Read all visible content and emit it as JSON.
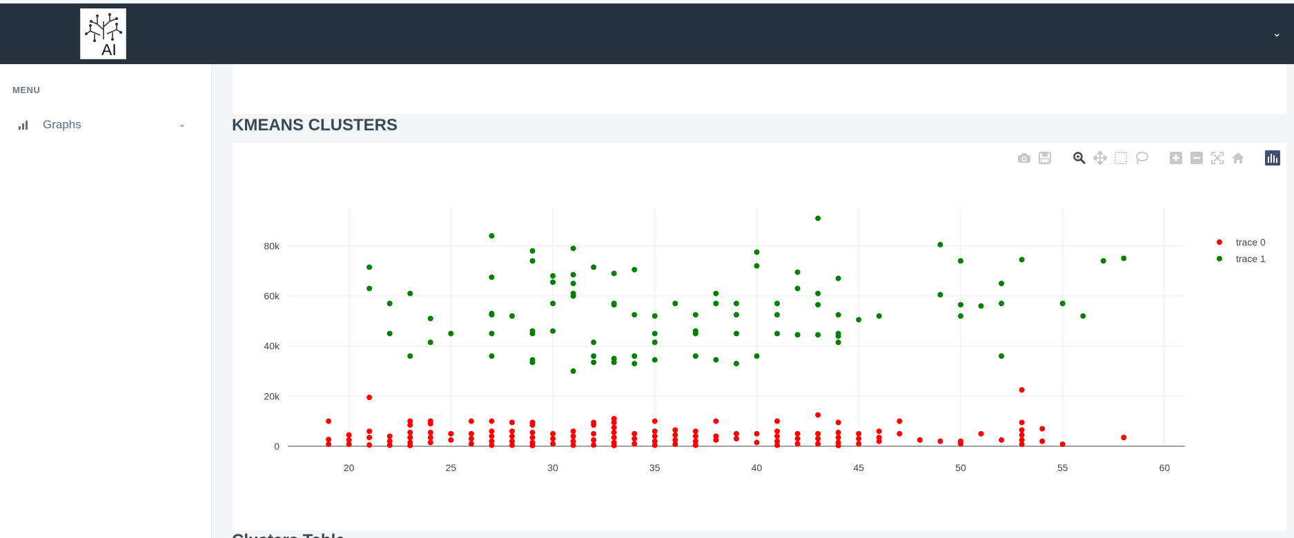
{
  "header": {
    "logo_text": "AI"
  },
  "sidebar": {
    "menu_title": "MENU",
    "items": [
      {
        "label": "Graphs",
        "icon": "bar-chart-icon"
      }
    ]
  },
  "main": {
    "section_title": "KMEANS CLUSTERS",
    "next_section_title": "Clusters Table"
  },
  "modebar": {
    "buttons": [
      "camera-icon",
      "save-icon",
      "zoom-icon",
      "pan-icon",
      "box-select-icon",
      "lasso-icon",
      "zoom-in-icon",
      "zoom-out-icon",
      "autoscale-icon",
      "reset-axes-icon",
      "plotly-logo-icon"
    ]
  },
  "chart_data": {
    "type": "scatter",
    "xlim": [
      17,
      61
    ],
    "ylim": [
      0,
      95000
    ],
    "xticks": [
      20,
      25,
      30,
      35,
      40,
      45,
      50,
      55,
      60
    ],
    "yticks": [
      0,
      20000,
      40000,
      60000,
      80000
    ],
    "ytick_labels": [
      "0",
      "20k",
      "40k",
      "60k",
      "80k"
    ],
    "grid": true,
    "legend": "top-right",
    "series": [
      {
        "name": "trace 0",
        "color": "#ff0000",
        "points": [
          [
            19,
            10000
          ],
          [
            19,
            2700
          ],
          [
            19,
            800
          ],
          [
            20,
            4500
          ],
          [
            20,
            2500
          ],
          [
            20,
            800
          ],
          [
            21,
            19500
          ],
          [
            21,
            6000
          ],
          [
            21,
            3500
          ],
          [
            21,
            500
          ],
          [
            22,
            4000
          ],
          [
            22,
            2000
          ],
          [
            22,
            400
          ],
          [
            23,
            10000
          ],
          [
            23,
            8500
          ],
          [
            23,
            5500
          ],
          [
            23,
            3500
          ],
          [
            23,
            1500
          ],
          [
            23,
            300
          ],
          [
            24,
            10000
          ],
          [
            24,
            9000
          ],
          [
            24,
            5500
          ],
          [
            24,
            3500
          ],
          [
            24,
            1500
          ],
          [
            25,
            5000
          ],
          [
            25,
            2500
          ],
          [
            26,
            10000
          ],
          [
            26,
            5000
          ],
          [
            26,
            3000
          ],
          [
            26,
            1000
          ],
          [
            27,
            10000
          ],
          [
            27,
            6000
          ],
          [
            27,
            4000
          ],
          [
            27,
            2000
          ],
          [
            27,
            400
          ],
          [
            28,
            9500
          ],
          [
            28,
            6000
          ],
          [
            28,
            4000
          ],
          [
            28,
            2000
          ],
          [
            28,
            400
          ],
          [
            29,
            9500
          ],
          [
            29,
            8500
          ],
          [
            29,
            5500
          ],
          [
            29,
            3500
          ],
          [
            29,
            1500
          ],
          [
            29,
            300
          ],
          [
            30,
            5000
          ],
          [
            30,
            3000
          ],
          [
            30,
            1000
          ],
          [
            31,
            6000
          ],
          [
            31,
            4000
          ],
          [
            31,
            2000
          ],
          [
            31,
            400
          ],
          [
            32,
            9500
          ],
          [
            32,
            8500
          ],
          [
            32,
            5000
          ],
          [
            32,
            2500
          ],
          [
            32,
            500
          ],
          [
            33,
            11000
          ],
          [
            33,
            9500
          ],
          [
            33,
            7500
          ],
          [
            33,
            5500
          ],
          [
            33,
            3500
          ],
          [
            33,
            1500
          ],
          [
            33,
            300
          ],
          [
            34,
            5000
          ],
          [
            34,
            3000
          ],
          [
            34,
            1000
          ],
          [
            35,
            10000
          ],
          [
            35,
            6000
          ],
          [
            35,
            4000
          ],
          [
            35,
            2000
          ],
          [
            35,
            400
          ],
          [
            36,
            6500
          ],
          [
            36,
            4500
          ],
          [
            36,
            2500
          ],
          [
            36,
            800
          ],
          [
            37,
            6000
          ],
          [
            37,
            4000
          ],
          [
            37,
            2000
          ],
          [
            37,
            400
          ],
          [
            38,
            10000
          ],
          [
            38,
            4000
          ],
          [
            38,
            2500
          ],
          [
            39,
            5000
          ],
          [
            39,
            3000
          ],
          [
            40,
            5000
          ],
          [
            40,
            1500
          ],
          [
            41,
            10000
          ],
          [
            41,
            6000
          ],
          [
            41,
            4000
          ],
          [
            41,
            2000
          ],
          [
            41,
            400
          ],
          [
            42,
            5000
          ],
          [
            42,
            3000
          ],
          [
            42,
            1000
          ],
          [
            43,
            12500
          ],
          [
            43,
            5000
          ],
          [
            43,
            3000
          ],
          [
            43,
            1000
          ],
          [
            44,
            9500
          ],
          [
            44,
            5500
          ],
          [
            44,
            3500
          ],
          [
            44,
            1500
          ],
          [
            44,
            300
          ],
          [
            45,
            5000
          ],
          [
            45,
            3000
          ],
          [
            45,
            1000
          ],
          [
            46,
            6000
          ],
          [
            46,
            3500
          ],
          [
            46,
            2000
          ],
          [
            47,
            10000
          ],
          [
            47,
            5000
          ],
          [
            48,
            2500
          ],
          [
            49,
            2000
          ],
          [
            50,
            2000
          ],
          [
            50,
            1000
          ],
          [
            51,
            5000
          ],
          [
            52,
            2500
          ],
          [
            53,
            22500
          ],
          [
            53,
            9500
          ],
          [
            53,
            6500
          ],
          [
            53,
            4500
          ],
          [
            53,
            2500
          ],
          [
            53,
            800
          ],
          [
            54,
            7000
          ],
          [
            54,
            2000
          ],
          [
            55,
            800
          ],
          [
            58,
            3500
          ]
        ]
      },
      {
        "name": "trace 1",
        "color": "#008000",
        "points": [
          [
            21,
            71500
          ],
          [
            21,
            63000
          ],
          [
            22,
            57000
          ],
          [
            22,
            45000
          ],
          [
            23,
            61000
          ],
          [
            23,
            36000
          ],
          [
            24,
            51000
          ],
          [
            24,
            41500
          ],
          [
            25,
            45000
          ],
          [
            27,
            84000
          ],
          [
            27,
            67500
          ],
          [
            27,
            53000
          ],
          [
            27,
            52500
          ],
          [
            27,
            45000
          ],
          [
            27,
            36000
          ],
          [
            28,
            52000
          ],
          [
            29,
            78000
          ],
          [
            29,
            74000
          ],
          [
            29,
            46000
          ],
          [
            29,
            45000
          ],
          [
            29,
            34500
          ],
          [
            29,
            33500
          ],
          [
            30,
            68000
          ],
          [
            30,
            65500
          ],
          [
            30,
            57000
          ],
          [
            30,
            46000
          ],
          [
            31,
            79000
          ],
          [
            31,
            68500
          ],
          [
            31,
            65000
          ],
          [
            31,
            61000
          ],
          [
            31,
            60000
          ],
          [
            31,
            30000
          ],
          [
            32,
            71500
          ],
          [
            32,
            41500
          ],
          [
            32,
            36000
          ],
          [
            32,
            33500
          ],
          [
            33,
            69000
          ],
          [
            33,
            57000
          ],
          [
            33,
            56500
          ],
          [
            33,
            35000
          ],
          [
            33,
            33500
          ],
          [
            34,
            70500
          ],
          [
            34,
            52500
          ],
          [
            34,
            36000
          ],
          [
            34,
            33000
          ],
          [
            35,
            52000
          ],
          [
            35,
            45000
          ],
          [
            35,
            41500
          ],
          [
            35,
            34500
          ],
          [
            36,
            57000
          ],
          [
            37,
            52500
          ],
          [
            37,
            46000
          ],
          [
            37,
            45000
          ],
          [
            37,
            36000
          ],
          [
            38,
            61000
          ],
          [
            38,
            57000
          ],
          [
            38,
            34500
          ],
          [
            39,
            57000
          ],
          [
            39,
            52500
          ],
          [
            39,
            45000
          ],
          [
            39,
            33000
          ],
          [
            40,
            77500
          ],
          [
            40,
            72000
          ],
          [
            40,
            36000
          ],
          [
            41,
            57000
          ],
          [
            41,
            52500
          ],
          [
            41,
            45000
          ],
          [
            42,
            69500
          ],
          [
            42,
            63000
          ],
          [
            42,
            44500
          ],
          [
            43,
            91000
          ],
          [
            43,
            61000
          ],
          [
            43,
            56500
          ],
          [
            43,
            44500
          ],
          [
            44,
            67000
          ],
          [
            44,
            52500
          ],
          [
            44,
            45000
          ],
          [
            44,
            44000
          ],
          [
            44,
            41500
          ],
          [
            45,
            50500
          ],
          [
            46,
            52000
          ],
          [
            49,
            80500
          ],
          [
            49,
            60500
          ],
          [
            50,
            74000
          ],
          [
            50,
            56500
          ],
          [
            50,
            52000
          ],
          [
            51,
            56000
          ],
          [
            52,
            65000
          ],
          [
            52,
            57000
          ],
          [
            52,
            36000
          ],
          [
            53,
            74500
          ],
          [
            55,
            57000
          ],
          [
            56,
            52000
          ],
          [
            57,
            74000
          ],
          [
            58,
            75000
          ]
        ]
      }
    ]
  }
}
